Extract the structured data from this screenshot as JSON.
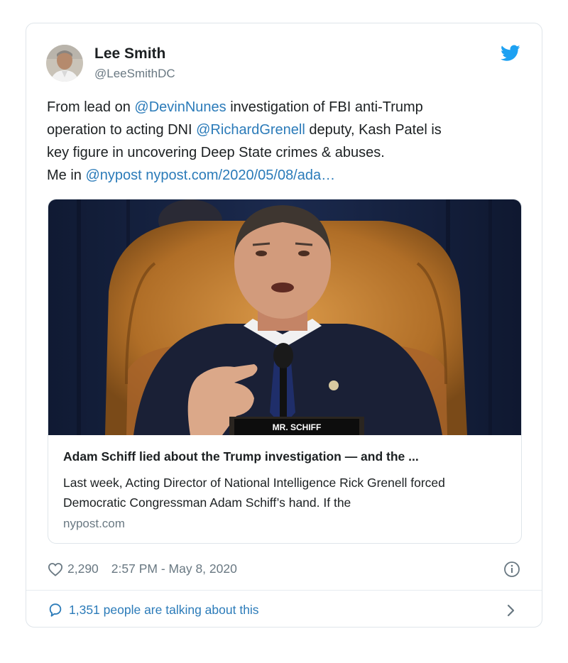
{
  "tweet": {
    "author_name": "Lee Smith",
    "author_handle": "@LeeSmithDC",
    "text_line1_a": "From lead on ",
    "mention_1": "@DevinNunes",
    "text_line1_b": " investigation of FBI anti-Trump",
    "text_line2_a": "operation to acting DNI ",
    "mention_2": "@RichardGrenell",
    "text_line2_b": " deputy, Kash Patel is",
    "text_line3": "key figure in uncovering Deep State crimes & abuses.",
    "text_line4_a": "Me in ",
    "mention_3": "@nypost",
    "url": "nypost.com/2020/05/08/ada…"
  },
  "link_card": {
    "photo_placard": "MR. SCHIFF",
    "title": "Adam Schiff lied about the Trump investigation — and the ...",
    "description": "Last week, Acting Director of National Intelligence Rick Grenell forced Democratic Congressman Adam Schiff’s hand. If the",
    "domain": "nypost.com"
  },
  "footer": {
    "likes": "2,290",
    "timestamp": "2:57 PM - May 8, 2020",
    "talking": "1,351 people are talking about this"
  },
  "colors": {
    "link": "#2b7bb9",
    "muted": "#697882",
    "twitter_blue": "#1da1f2"
  },
  "icons": [
    "twitter-bird-icon",
    "heart-icon",
    "info-icon",
    "comment-bubble-icon",
    "chevron-right-icon"
  ]
}
